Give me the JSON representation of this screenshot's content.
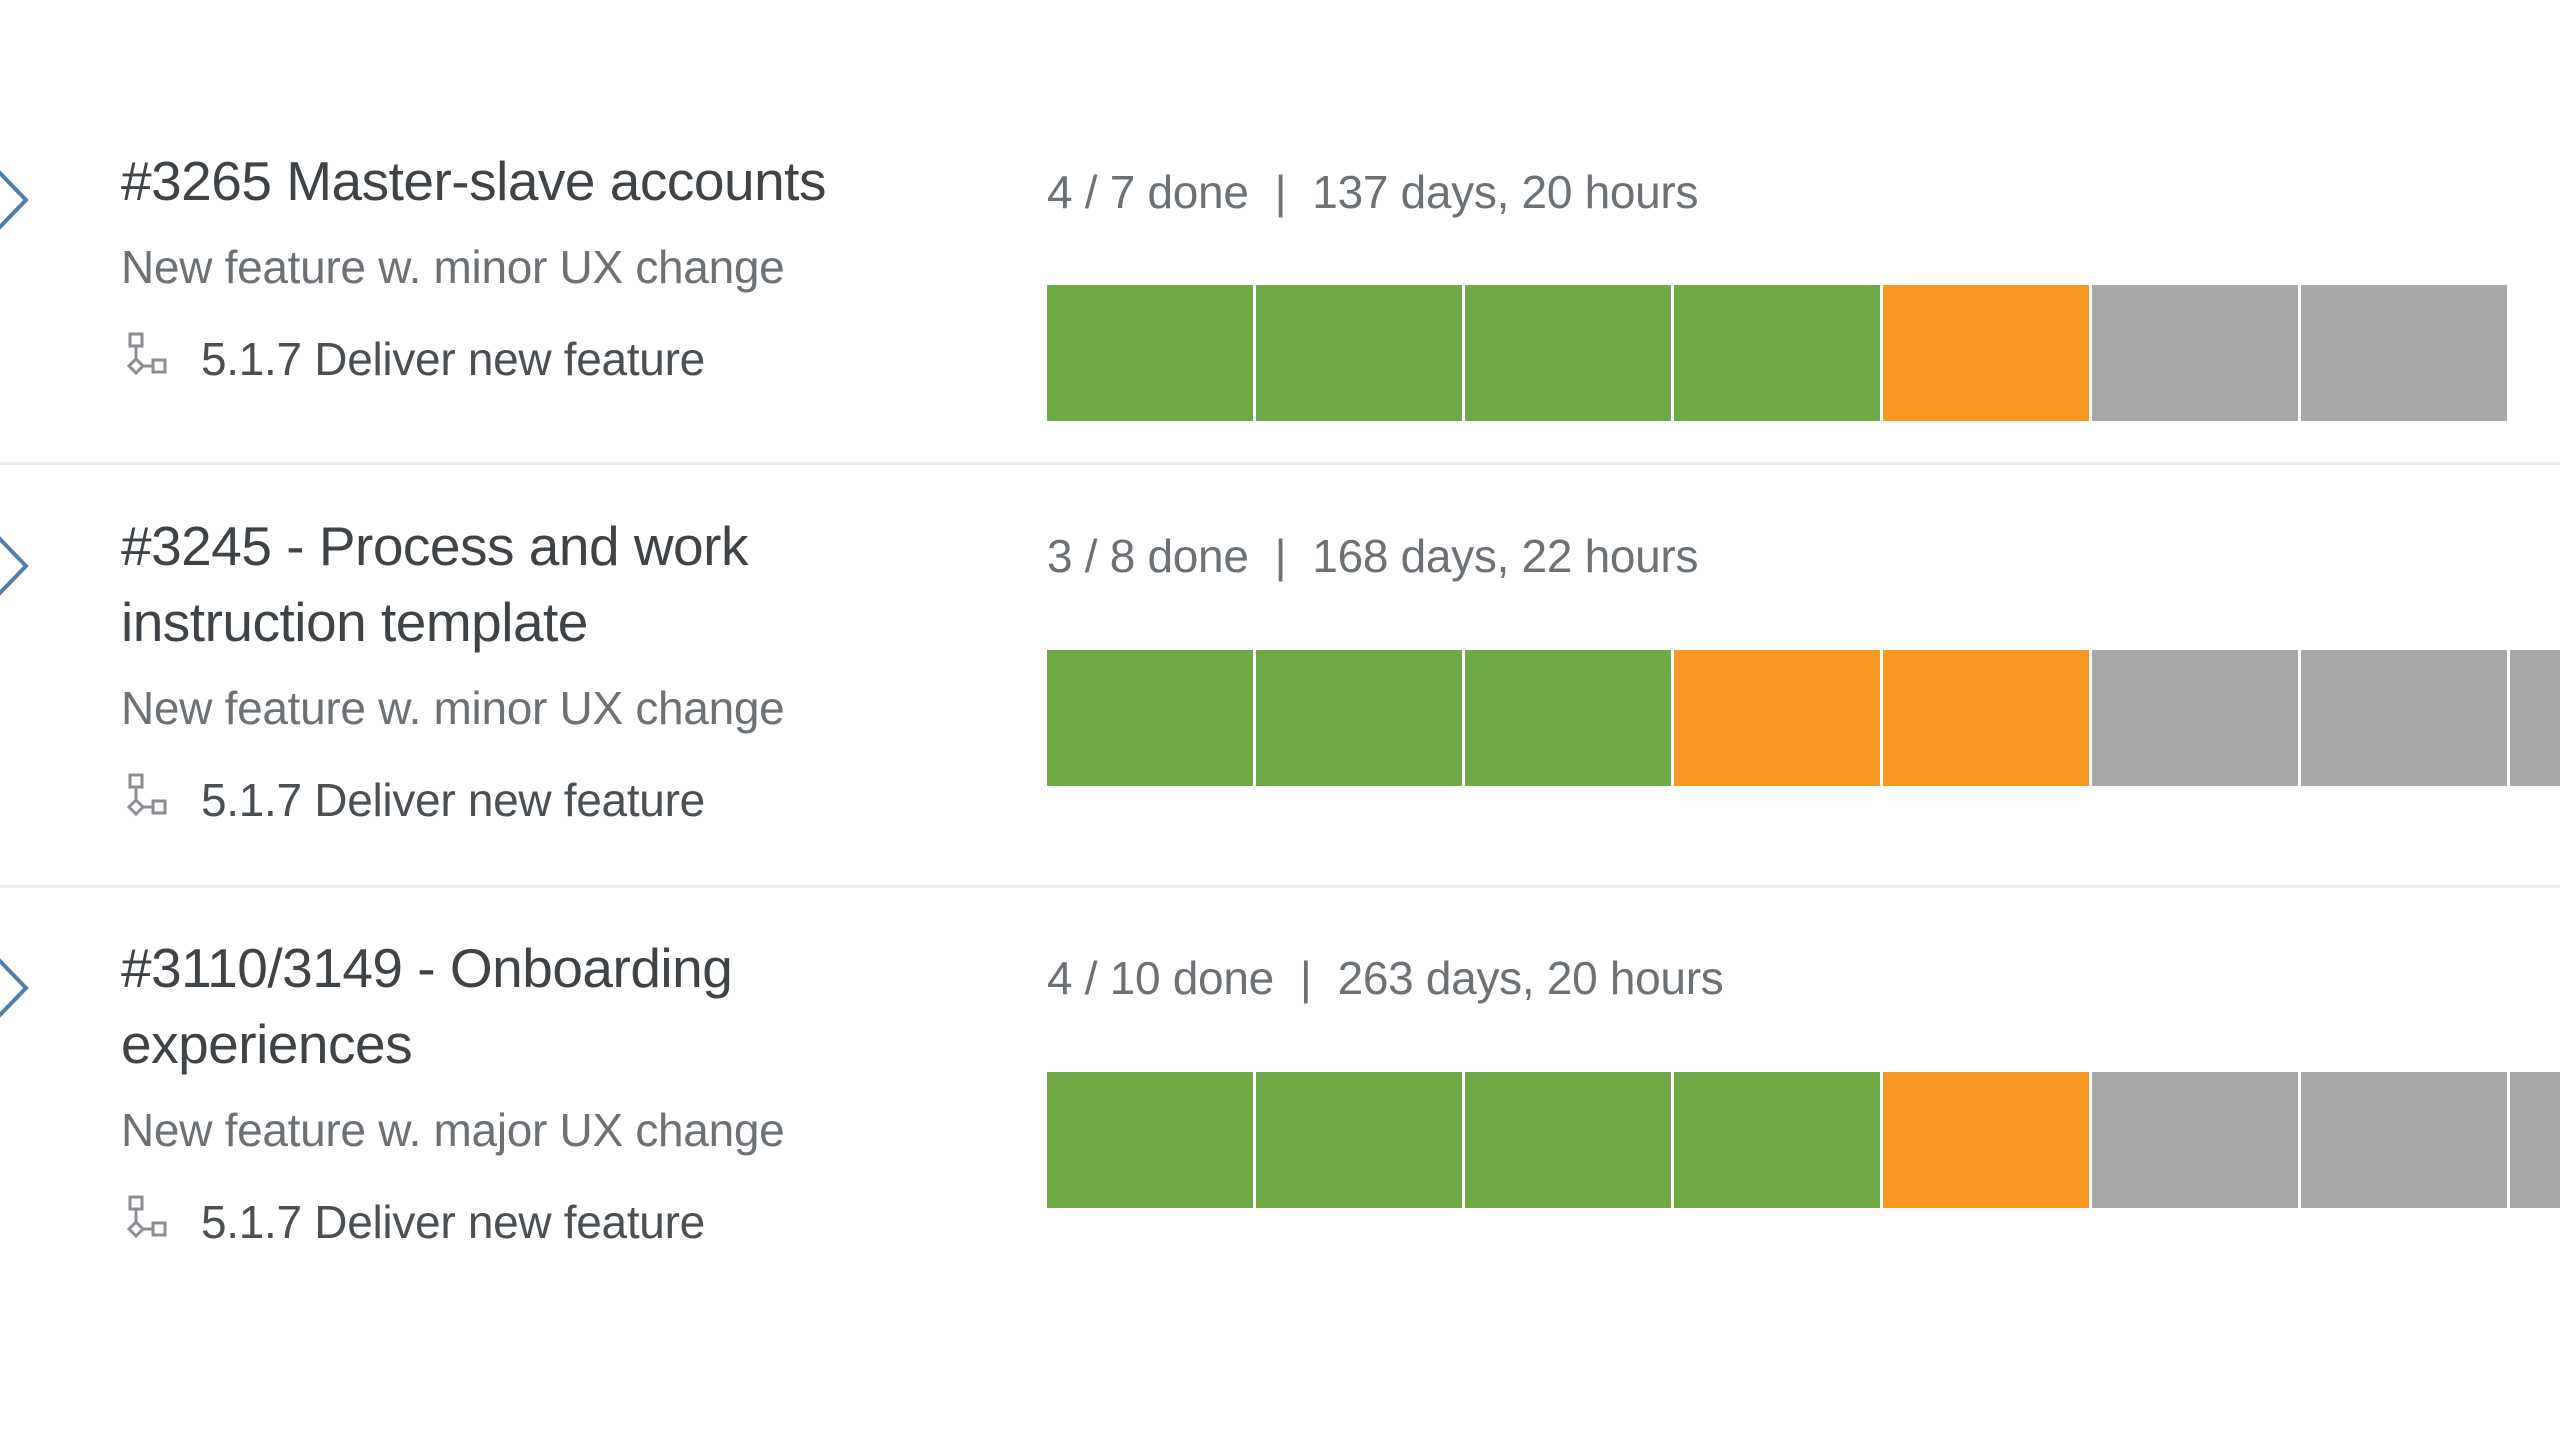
{
  "colors": {
    "done": "#6daa46",
    "in_progress": "#f89722",
    "todo": "#a8a8a8",
    "chevron": "#4f7fa8",
    "separator": "#ececec"
  },
  "icons": {
    "expand": "chevron-right-icon",
    "goal": "hierarchy-icon"
  },
  "items": [
    {
      "title": "#3265 Master-slave accounts",
      "type": "New feature w. minor UX change",
      "goal": "5.1.7 Deliver new feature",
      "done_label": "4 / 7 done",
      "separator": "|",
      "duration": "137 days, 20 hours",
      "progress": {
        "done": 4,
        "total": 7
      },
      "segments": [
        "done",
        "done",
        "done",
        "done",
        "in_progress",
        "todo",
        "todo"
      ]
    },
    {
      "title": "#3245 - Process and work instruction template",
      "type": "New feature w. minor UX change",
      "goal": "5.1.7 Deliver new feature",
      "done_label": "3 / 8 done",
      "separator": "|",
      "duration": "168 days, 22 hours",
      "progress": {
        "done": 3,
        "total": 8
      },
      "segments": [
        "done",
        "done",
        "done",
        "in_progress",
        "in_progress",
        "todo",
        "todo",
        "todo"
      ]
    },
    {
      "title": "#3110/3149 - Onboarding experiences",
      "type": "New feature w. major UX change",
      "goal": "5.1.7 Deliver new feature",
      "done_label": "4 / 10 done",
      "separator": "|",
      "duration": "263 days, 20 hours",
      "progress": {
        "done": 4,
        "total": 10
      },
      "segments": [
        "done",
        "done",
        "done",
        "done",
        "in_progress",
        "todo",
        "todo",
        "todo",
        "todo",
        "todo"
      ]
    }
  ]
}
